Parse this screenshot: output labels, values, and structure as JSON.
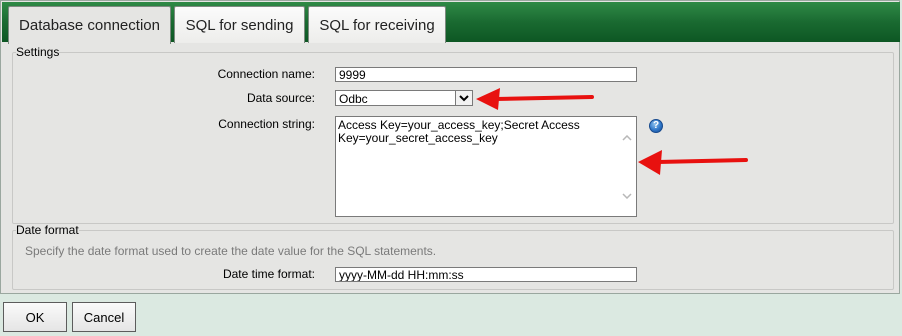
{
  "tabs": [
    {
      "label": "Database connection"
    },
    {
      "label": "SQL for sending"
    },
    {
      "label": "SQL for receiving"
    }
  ],
  "settings": {
    "legend": "Settings",
    "connection_name_label": "Connection name:",
    "connection_name_value": "9999",
    "data_source_label": "Data source:",
    "data_source_value": "Odbc",
    "connection_string_label": "Connection string:",
    "connection_string_value": "Access Key=your_access_key;Secret Access Key=your_secret_access_key"
  },
  "date_format": {
    "legend": "Date format",
    "hint": "Specify the date format used to create the date value for the SQL statements.",
    "date_time_label": "Date time format:",
    "date_time_value": "yyyy-MM-dd HH:mm:ss"
  },
  "buttons": {
    "ok": "OK",
    "cancel": "Cancel"
  },
  "icons": {
    "help": "help-icon",
    "dropdown": "chevron-down-icon",
    "scroll_up": "scroll-up-icon",
    "scroll_down": "scroll-down-icon",
    "annotation_arrow": "red-arrow"
  },
  "colors": {
    "tab_bar": "#1a6a31",
    "annotation": "#e8110f",
    "help": "#2f76c8"
  }
}
